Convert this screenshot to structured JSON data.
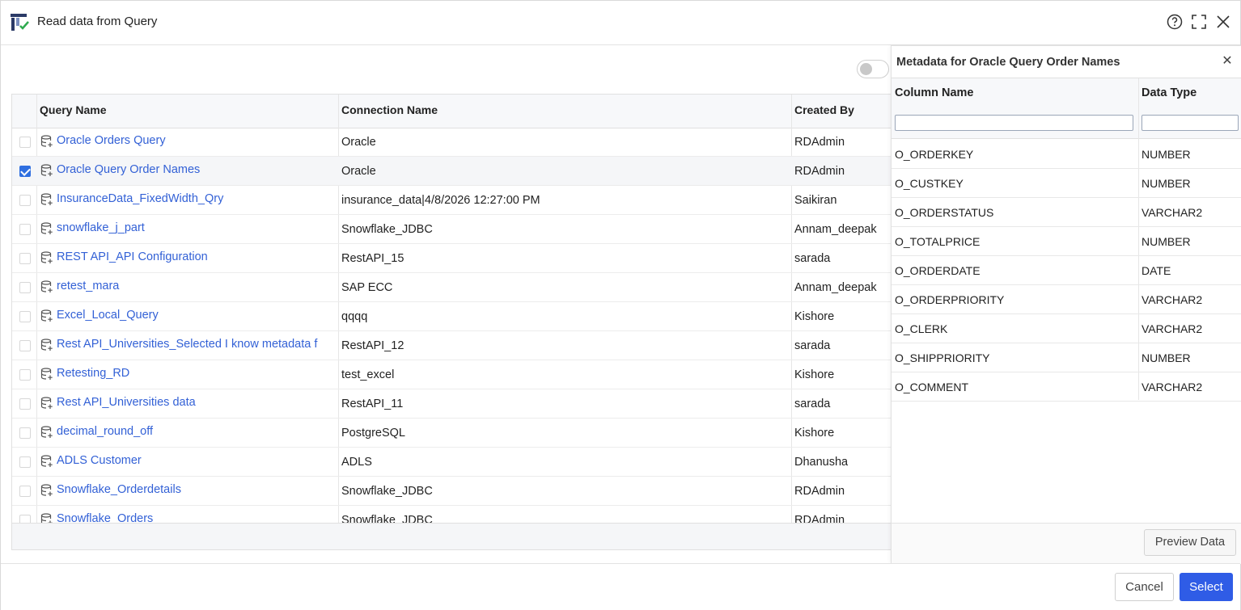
{
  "dialog": {
    "title": "Read data from Query",
    "icons": {
      "app": "query-app-icon",
      "help": "help-icon",
      "maximize": "maximize-icon",
      "close": "close-icon"
    }
  },
  "grid": {
    "columns": [
      "Query Name",
      "Connection Name",
      "Created By"
    ],
    "rows": [
      {
        "name": "Oracle Orders Query",
        "connection": "Oracle",
        "created_by": "RDAdmin",
        "checked": false
      },
      {
        "name": "Oracle Query Order Names",
        "connection": "Oracle",
        "created_by": "RDAdmin",
        "checked": true
      },
      {
        "name": "InsuranceData_FixedWidth_Qry",
        "connection": "insurance_data|4/8/2026 12:27:00 PM",
        "created_by": "Saikiran",
        "checked": false
      },
      {
        "name": "snowflake_j_part",
        "connection": "Snowflake_JDBC",
        "created_by": "Annam_deepak",
        "checked": false
      },
      {
        "name": "REST API_API Configuration",
        "connection": "RestAPI_15",
        "created_by": "sarada",
        "checked": false
      },
      {
        "name": "retest_mara",
        "connection": "SAP ECC",
        "created_by": "Annam_deepak",
        "checked": false
      },
      {
        "name": "Excel_Local_Query",
        "connection": "qqqq",
        "created_by": "Kishore",
        "checked": false
      },
      {
        "name": "Rest API_Universities_Selected I know metadata f",
        "connection": "RestAPI_12",
        "created_by": "sarada",
        "checked": false
      },
      {
        "name": "Retesting_RD",
        "connection": "test_excel",
        "created_by": "Kishore",
        "checked": false
      },
      {
        "name": "Rest API_Universities data",
        "connection": "RestAPI_11",
        "created_by": "sarada",
        "checked": false
      },
      {
        "name": "decimal_round_off",
        "connection": "PostgreSQL",
        "created_by": "Kishore",
        "checked": false
      },
      {
        "name": "ADLS Customer",
        "connection": "ADLS",
        "created_by": "Dhanusha",
        "checked": false
      },
      {
        "name": "Snowflake_Orderdetails",
        "connection": "Snowflake_JDBC",
        "created_by": "RDAdmin",
        "checked": false
      },
      {
        "name": "Snowflake_Orders",
        "connection": "Snowflake_JDBC",
        "created_by": "RDAdmin",
        "checked": false
      }
    ],
    "toggle_on": false
  },
  "metadata": {
    "title": "Metadata for Oracle Query Order Names",
    "columns": [
      "Column Name",
      "Data Type"
    ],
    "rows": [
      {
        "column": "O_ORDERKEY",
        "type": "NUMBER"
      },
      {
        "column": "O_CUSTKEY",
        "type": "NUMBER"
      },
      {
        "column": "O_ORDERSTATUS",
        "type": "VARCHAR2"
      },
      {
        "column": "O_TOTALPRICE",
        "type": "NUMBER"
      },
      {
        "column": "O_ORDERDATE",
        "type": "DATE"
      },
      {
        "column": "O_ORDERPRIORITY",
        "type": "VARCHAR2"
      },
      {
        "column": "O_CLERK",
        "type": "VARCHAR2"
      },
      {
        "column": "O_SHIPPRIORITY",
        "type": "NUMBER"
      },
      {
        "column": "O_COMMENT",
        "type": "VARCHAR2"
      }
    ],
    "filter_column_name": "",
    "filter_data_type": "",
    "preview_label": "Preview Data"
  },
  "footer": {
    "cancel_label": "Cancel",
    "select_label": "Select"
  },
  "colors": {
    "link": "#3361d6",
    "primary": "#2f5ce6",
    "checkbox": "#2f6fe0"
  }
}
